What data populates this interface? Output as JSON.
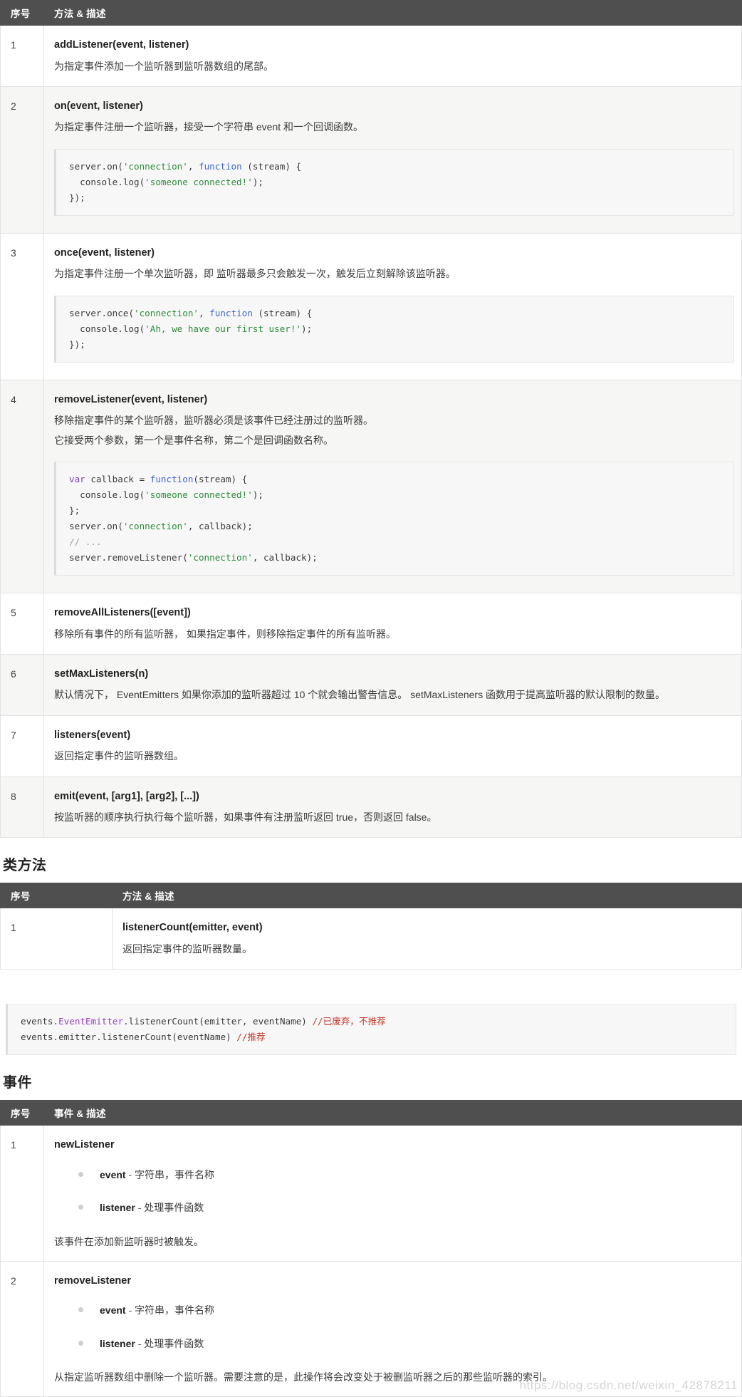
{
  "methods_table": {
    "headers": {
      "index": "序号",
      "desc": "方法 & 描述"
    },
    "rows": [
      {
        "index": "1",
        "name": "addListener(event, listener)",
        "desc": "为指定事件添加一个监听器到监听器数组的尾部。",
        "code": null
      },
      {
        "index": "2",
        "name": "on(event, listener)",
        "desc": "为指定事件注册一个监听器，接受一个字符串 event 和一个回调函数。",
        "code": [
          [
            {
              "t": "server.on(",
              "c": "pln"
            },
            {
              "t": "'connection'",
              "c": "str"
            },
            {
              "t": ", ",
              "c": "pln"
            },
            {
              "t": "function",
              "c": "k"
            },
            {
              "t": " (stream) {",
              "c": "pln"
            }
          ],
          [
            {
              "t": "  console.log(",
              "c": "pln"
            },
            {
              "t": "'someone connected!'",
              "c": "str"
            },
            {
              "t": ");",
              "c": "pln"
            }
          ],
          [
            {
              "t": "});",
              "c": "pln"
            }
          ]
        ]
      },
      {
        "index": "3",
        "name": "once(event, listener)",
        "desc": "为指定事件注册一个单次监听器，即 监听器最多只会触发一次，触发后立刻解除该监听器。",
        "code": [
          [
            {
              "t": "server.once(",
              "c": "pln"
            },
            {
              "t": "'connection'",
              "c": "str"
            },
            {
              "t": ", ",
              "c": "pln"
            },
            {
              "t": "function",
              "c": "k"
            },
            {
              "t": " (stream) {",
              "c": "pln"
            }
          ],
          [
            {
              "t": "  console.log(",
              "c": "pln"
            },
            {
              "t": "'Ah, we have our first user!'",
              "c": "str"
            },
            {
              "t": ");",
              "c": "pln"
            }
          ],
          [
            {
              "t": "});",
              "c": "pln"
            }
          ]
        ]
      },
      {
        "index": "4",
        "name": "removeListener(event, listener)",
        "desc": "移除指定事件的某个监听器，监听器必须是该事件已经注册过的监听器。",
        "desc2": "它接受两个参数，第一个是事件名称，第二个是回调函数名称。",
        "code": [
          [
            {
              "t": "var",
              "c": "kv"
            },
            {
              "t": " callback = ",
              "c": "pln"
            },
            {
              "t": "function",
              "c": "k"
            },
            {
              "t": "(stream) {",
              "c": "pln"
            }
          ],
          [
            {
              "t": "  console.log(",
              "c": "pln"
            },
            {
              "t": "'someone connected!'",
              "c": "str"
            },
            {
              "t": ");",
              "c": "pln"
            }
          ],
          [
            {
              "t": "};",
              "c": "pln"
            }
          ],
          [
            {
              "t": "server.on(",
              "c": "pln"
            },
            {
              "t": "'connection'",
              "c": "str"
            },
            {
              "t": ", callback);",
              "c": "pln"
            }
          ],
          [
            {
              "t": "// ...",
              "c": "cmt"
            }
          ],
          [
            {
              "t": "server.removeListener(",
              "c": "pln"
            },
            {
              "t": "'connection'",
              "c": "str"
            },
            {
              "t": ", callback);",
              "c": "pln"
            }
          ]
        ]
      },
      {
        "index": "5",
        "name": "removeAllListeners([event])",
        "desc": "移除所有事件的所有监听器， 如果指定事件，则移除指定事件的所有监听器。",
        "code": null
      },
      {
        "index": "6",
        "name": "setMaxListeners(n)",
        "desc": "默认情况下， EventEmitters 如果你添加的监听器超过 10 个就会输出警告信息。 setMaxListeners 函数用于提高监听器的默认限制的数量。",
        "code": null
      },
      {
        "index": "7",
        "name": "listeners(event)",
        "desc": "返回指定事件的监听器数组。",
        "code": null
      },
      {
        "index": "8",
        "name": "emit(event, [arg1], [arg2], [...])",
        "desc": "按监听器的顺序执行执行每个监听器，如果事件有注册监听返回 true，否则返回 false。",
        "code": null
      }
    ]
  },
  "class_methods": {
    "heading": "类方法",
    "headers": {
      "index": "序号",
      "desc": "方法 & 描述"
    },
    "rows": [
      {
        "index": "1",
        "name": "listenerCount(emitter, event)",
        "desc": "返回指定事件的监听器数量。"
      }
    ]
  },
  "standalone_code": [
    [
      {
        "t": "events.",
        "c": "pln"
      },
      {
        "t": "EventEmitter",
        "c": "cls"
      },
      {
        "t": ".listenerCount(emitter, eventName) ",
        "c": "pln"
      },
      {
        "t": "//已废弃，不推荐",
        "c": "cmt-red"
      }
    ],
    [
      {
        "t": "events.emitter.listenerCount(eventName) ",
        "c": "pln"
      },
      {
        "t": "//推荐",
        "c": "cmt-red"
      }
    ]
  ],
  "events_section": {
    "heading": "事件",
    "headers": {
      "index": "序号",
      "desc": "事件 & 描述"
    },
    "rows": [
      {
        "index": "1",
        "name": "newListener",
        "params": [
          {
            "name": "event",
            "sep": " - ",
            "desc": "字符串，事件名称"
          },
          {
            "name": "listener",
            "sep": " - ",
            "desc": "处理事件函数"
          }
        ],
        "footer": "该事件在添加新监听器时被触发。"
      },
      {
        "index": "2",
        "name": "removeListener",
        "params": [
          {
            "name": "event",
            "sep": " - ",
            "desc": "字符串，事件名称"
          },
          {
            "name": "listener",
            "sep": " - ",
            "desc": "处理事件函数"
          }
        ],
        "footer": "从指定监听器数组中删除一个监听器。需要注意的是，此操作将会改变处于被删监听器之后的那些监听器的索引。"
      }
    ]
  },
  "watermark": "https://blog.csdn.net/weixin_42878211"
}
